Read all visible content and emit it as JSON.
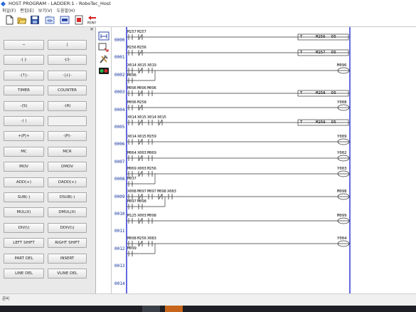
{
  "window": {
    "title": "HOST PROGRAM - LADDER:1 - RoboTec_Host"
  },
  "menu": [
    "파일(F)",
    "편집(E)",
    "보기(V)",
    "도움말(H)"
  ],
  "toolbar": {
    "icons": [
      "new-icon",
      "open-icon",
      "save-icon",
      "connect-icon",
      "monitor-icon",
      "print-icon",
      "point-icon"
    ],
    "point_label": "POINT",
    "monitor_label": "RUN"
  },
  "palette": {
    "close": "×",
    "rows": [
      [
        "─",
        "|"
      ],
      [
        "-| |-",
        "-|/|-"
      ],
      [
        "-|↑|-",
        "-|↓|-"
      ],
      [
        "TIMER",
        "COUNTER"
      ],
      [
        "-(S)",
        "-(R)"
      ],
      [
        "-( )",
        ""
      ],
      [
        "+|P|+",
        "-|P|-"
      ],
      [
        "MC",
        "MCR"
      ],
      [
        "MOV",
        "DMOV"
      ],
      [
        "ADD(+)",
        "DADD(+)"
      ],
      [
        "SUB(-)",
        "DSUB(-)"
      ],
      [
        "MUL(X)",
        "DMUL(X)"
      ],
      [
        "DIV(\\)",
        "DDIV(\\)"
      ],
      [
        "LEFT SHIFT",
        "RIGHT SHIFT"
      ],
      [
        "PART DEL",
        "INSERT"
      ],
      [
        "LINE DEL",
        "VLINE DEL"
      ]
    ]
  },
  "side_icons": [
    "ladder-view-icon",
    "transfer-icon",
    "tools-icon",
    "compile-icon"
  ],
  "ladder": {
    "rows": [
      "0000",
      "0001",
      "0002",
      "0003",
      "0004",
      "0005",
      "0006",
      "0007",
      "0008",
      "0009",
      "0010",
      "0011",
      "0012",
      "0013",
      "0014"
    ],
    "rungs": [
      {
        "contacts": [
          "M257",
          "M257"
        ],
        "coil": [
          "T",
          "M256",
          "D5"
        ]
      },
      {
        "contacts": [
          "M256",
          "M256"
        ],
        "coil": [
          "T",
          "M257",
          "D5"
        ]
      },
      {
        "contacts": [
          "X014",
          "X015",
          "X019"
        ],
        "branch": [
          "M096"
        ],
        "coil": [
          "M096"
        ]
      },
      {
        "contacts": [
          "M096",
          "M096",
          "M096"
        ],
        "coil": [
          "T",
          "M258",
          "D5"
        ]
      },
      {
        "contacts": [
          "M096",
          "M258"
        ],
        "coil": [
          "Y008"
        ]
      },
      {
        "contacts": [
          "X014",
          "X015",
          "X014",
          "X015"
        ],
        "coil": [
          "T",
          "M259",
          "D5"
        ]
      },
      {
        "contacts": [
          "X014",
          "X015",
          "M259"
        ],
        "coil": [
          "Y009"
        ]
      },
      {
        "contacts": [
          "M064",
          "X003",
          "M069"
        ],
        "coil": [
          "Y002"
        ]
      },
      {
        "contacts": [
          "M069",
          "X003",
          "M256"
        ],
        "branch": [
          "M037"
        ],
        "coil": [
          "Y003"
        ]
      },
      {
        "contacts": [
          "X008",
          "M097",
          "M097",
          "M098",
          "X083"
        ],
        "branch": [
          "M097",
          "M098"
        ],
        "coil": [
          "M098"
        ]
      },
      {
        "contacts": [
          "M125",
          "X003",
          "M098"
        ],
        "coil": [
          "M099"
        ]
      },
      {
        "contacts": [
          "M098",
          "M256",
          "X083"
        ],
        "branch": [
          "M099"
        ],
        "coil": [
          "Y004"
        ]
      }
    ]
  },
  "status": {
    "text": "준비"
  },
  "colors": {
    "rail": "#1f2ccf",
    "row_number": "#0a2b9a",
    "taskbar": "#1d1f25",
    "accent_taskbar": "#c7651c"
  }
}
